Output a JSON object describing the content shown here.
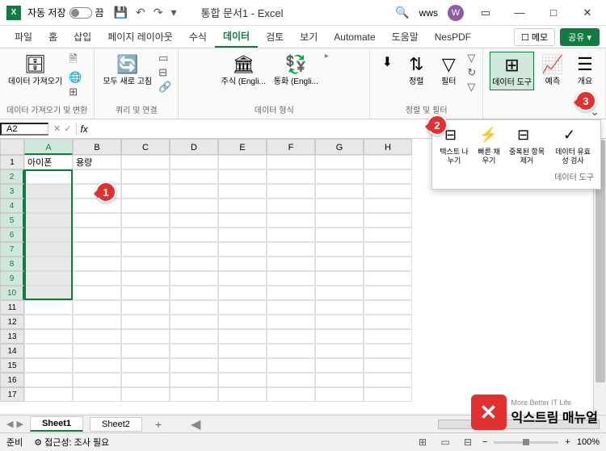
{
  "title_bar": {
    "autosave_label": "자동 저장",
    "autosave_state": "끔",
    "doc_title": "통합 문서1 - Excel",
    "user_name": "wws",
    "user_initial": "W"
  },
  "tabs": {
    "file": "파일",
    "home": "홈",
    "insert": "삽입",
    "page_layout": "페이지 레이아웃",
    "formulas": "수식",
    "data": "데이터",
    "review": "검토",
    "view": "보기",
    "automate": "Automate",
    "help": "도움말",
    "nespdf": "NesPDF",
    "memo": "메모",
    "share": "공유"
  },
  "ribbon": {
    "get_data": "데이터\n가져오기",
    "group1": "데이터 가져오기 및 변환",
    "refresh_all": "모두 새로\n고침",
    "group2": "쿼리 및 연결",
    "stocks": "주식 (Engli...",
    "currency": "통화 (Engli...",
    "group3": "데이터 형식",
    "sort": "정렬",
    "filter": "필터",
    "group4": "정렬 및 필터",
    "data_tools": "데이터\n도구",
    "forecast": "예측",
    "outline": "개요"
  },
  "dropdown": {
    "text_to_cols": "텍스트\n나누기",
    "flash_fill": "빠른\n채우기",
    "remove_dup": "중복된\n항목 제거",
    "data_validation": "데이터\n유효성 검사",
    "group_label": "데이터 도구"
  },
  "formula_bar": {
    "name_box": "A2"
  },
  "grid": {
    "cols": [
      "A",
      "B",
      "C",
      "D",
      "E",
      "F",
      "G",
      "H"
    ],
    "rows": [
      "1",
      "2",
      "3",
      "4",
      "5",
      "6",
      "7",
      "8",
      "9",
      "10",
      "11",
      "12",
      "13",
      "14",
      "15",
      "16",
      "17"
    ],
    "a1": "아이폰",
    "b1": "용량"
  },
  "sheets": {
    "sheet1": "Sheet1",
    "sheet2": "Sheet2"
  },
  "status": {
    "ready": "준비",
    "accessibility": "접근성: 조사 필요",
    "zoom": "100%"
  },
  "badges": {
    "b1": "1",
    "b2": "2",
    "b3": "3"
  },
  "watermark": {
    "brand": "익스트림 매뉴얼",
    "tagline": "More Better IT Life"
  }
}
